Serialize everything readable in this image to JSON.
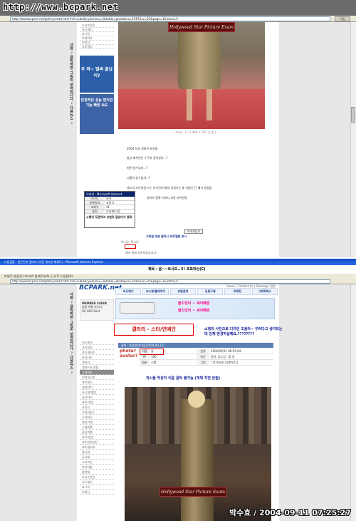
{
  "watermark": "http://www.bcpark.net",
  "top_browser": {
    "url": "http://www.bcpark.net/gallery/read.html?ref=subdiary&menu=3&table=photo&no=1987&sc=25&page=1&istart=0",
    "go_label": "이동",
    "vertical_text": "사랑 ~ 클릭하면 그림이 보여집니다 ~ 다음뉴스 ~",
    "left_menu": [
      "조교수연진",
      "속도재기",
      "포그릭",
      "보여줘요",
      "이연진",
      "포토앨범"
    ],
    "ad1_text": "우 와~ 벌써 끝났어?",
    "ad2_text": "안정적인 성능 편리한 기능 빠른 속도",
    "photo_watermark": "Hollywood Star Picture Exam",
    "photo_caption": "[ View : 0 ] [ 468 x 700 ] [ 원 ]",
    "body_lines": [
      "2004 도일 영화의 포토들",
      "항상 배치연은 누구와 걸어있다...?",
      "떠린 실수입자...?",
      "니콜의 실수입자...?",
      "레드의 보인처럼 드는 아시민의 별의 치칭치는 좋 사람인 단 예기 말씀을",
      "영어와 얼룩 이미지 과일 자유한정"
    ],
    "popup": {
      "title": "이미지 - Microsoft Internet Explorer",
      "rows": [
        [
          "아이디",
          "비어"
        ],
        [
          "등록일자",
          "포함석"
        ],
        [
          "조회수",
          "41"
        ],
        [
          "출처",
          "조선제/다음"
        ]
      ],
      "footer": "소행의 무관하여 코멘트 달았다가 종료"
    },
    "confirm_btn": "이미지닫기",
    "bottom_link": "고화질 부분 클릭시 포토앨범 표시",
    "comment_labels": [
      "의 나는 로그인",
      "에서 원래 부분되었습니다."
    ]
  },
  "second_window": {
    "title": "다음꿈을 - 검은전자 갤러리 (사진 게시판 해체도) - Microsoft Internet Explorer",
    "balloon_msg": "제목 : 음~~트사오..!!! 포토마산(C)",
    "menubar": "파일(F)  편집(E)  보기(V)  즐겨찾기(A)  도구(T)  도움말(H)",
    "url": "http://www.bcpark.net/gallery/read.html?ref=subdiary&menu=3&table=photo&no=1987&sc=25&page=1&istart=0"
  },
  "site": {
    "logo": "BCPARK.net",
    "top_links": "Home  |  Contact Us  |  Sitemap  |  영문",
    "nav": [
      "속도재기",
      "초소형/플레이어",
      "포럼검색",
      "공동구매",
      "트래킹",
      "그래픽레스"
    ],
    "member_title": "MEMBER LOGIN",
    "member_lines": [
      "꿈을 바꿀 분니다.",
      "00,100 Point"
    ],
    "ad_line1": "불끄었어 ~ 써어빠른",
    "ad_line2": "불끄었어 ~ 써어빠른",
    "gallery_title": "갤러리 - 스타/연예인",
    "annotation": "소행의 사진으로 디자인 조율라~ 꾸러다고 생각되는데 언제 변경하실께요.????????",
    "left_menu": [
      "속도체크",
      "가속정보",
      "포토갤러리",
      "유저사진",
      "갤러리",
      "캠퍼스타 종합",
      "그래픽인",
      "지역게시판",
      "포토데이",
      "실험방기",
      "초소형/앨범",
      "공부하기",
      "포토/게임",
      "사진인",
      "조용한동소",
      "스타마건",
      "방송가재",
      "소형여행",
      "관심여행",
      "자료/일반",
      "포토업계사진",
      "포토갤러리",
      "합식관",
      "공유래",
      "스포츠인",
      "미디어방",
      "합방데",
      "조교수연진",
      "속도재기",
      "포그릭",
      "이연진"
    ],
    "left_menu_highlight_index": 6,
    "info_header": "출처 : 조선일보/다음(2004,09.11)",
    "photo_avatar": "photo? avatar?",
    "info_rows": [
      {
        "k": "이름",
        "v": "술",
        "k2": "분류",
        "v2": "2004/09/11 06:52:04"
      },
      {
        "k": "IP",
        "v": "180",
        "k2": "최근",
        "v2": "동영, 엄소상 : 좋 영"
      },
      {
        "k": "원본",
        "v": "소행",
        "k2": "그림",
        "v2": "[ 안가대사] [일반안다]"
      }
    ],
    "request_line": "게시물 작성자 이름 클릭 불가능 (개체 치면 안됨)",
    "photo_watermark": "Hollywood Star Picture Exam",
    "signature": "박수효 / 2004-09-11 07:25:27"
  }
}
